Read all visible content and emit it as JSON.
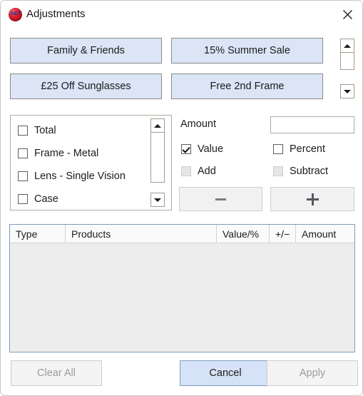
{
  "window": {
    "title": "Adjustments",
    "icon": "dotnet-icon",
    "icon_text": ".NET",
    "close_icon": "close-icon"
  },
  "presets": {
    "buttons": [
      {
        "label": "Family & Friends"
      },
      {
        "label": "15% Summer Sale"
      },
      {
        "label": "£25 Off Sunglasses"
      },
      {
        "label": "Free 2nd Frame"
      }
    ],
    "scroll_up_icon": "triangle-up-icon",
    "scroll_down_icon": "triangle-down-icon"
  },
  "product_list": {
    "items": [
      {
        "label": "Total",
        "checked": false
      },
      {
        "label": "Frame - Metal",
        "checked": false
      },
      {
        "label": "Lens - Single Vision",
        "checked": false
      },
      {
        "label": "Case",
        "checked": false
      }
    ],
    "scroll_up_icon": "triangle-up-icon",
    "scroll_down_icon": "triangle-down-icon"
  },
  "adjustment": {
    "amount_label": "Amount",
    "amount_value": "",
    "amount_placeholder": "",
    "options": [
      {
        "label": "Value",
        "checked": true,
        "disabled": false
      },
      {
        "label": "Percent",
        "checked": false,
        "disabled": false
      },
      {
        "label": "Add",
        "checked": false,
        "disabled": true
      },
      {
        "label": "Subtract",
        "checked": false,
        "disabled": true
      }
    ],
    "decrement_icon": "minus-icon",
    "increment_icon": "plus-icon"
  },
  "table": {
    "columns": [
      "Type",
      "Products",
      "Value/%",
      "+/−",
      "Amount"
    ],
    "rows": []
  },
  "footer": {
    "clear_all_label": "Clear All",
    "cancel_label": "Cancel",
    "apply_label": "Apply"
  },
  "colors": {
    "preset_fill": "#dbe5f6",
    "default_button_fill": "#d6e2f7",
    "table_border": "#7c9ec0",
    "table_body_fill": "#ededed",
    "disabled_text": "#9b9b9b"
  }
}
